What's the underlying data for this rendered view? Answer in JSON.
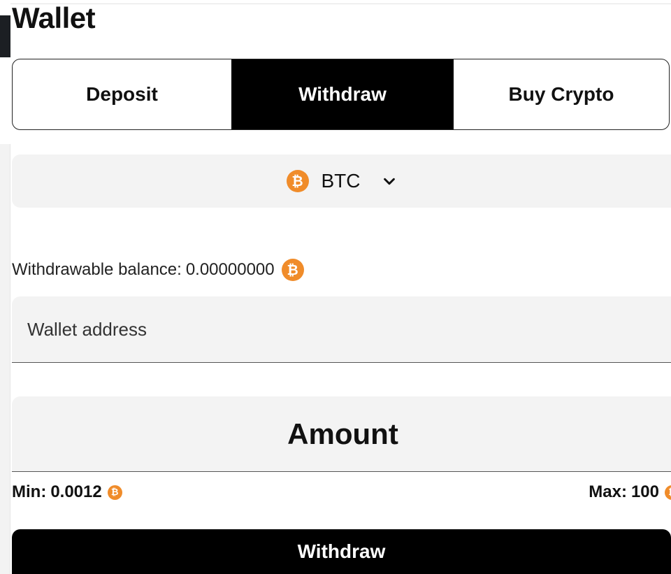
{
  "wallet": {
    "title": "Wallet",
    "tabs": [
      {
        "label": "Deposit",
        "active": false
      },
      {
        "label": "Withdraw",
        "active": true
      },
      {
        "label": "Buy Crypto",
        "active": false
      }
    ],
    "currency": {
      "code": "BTC",
      "icon": "bitcoin-icon",
      "icon_glyph": "₿",
      "dropdown_icon": "chevron-down-icon"
    },
    "balance": {
      "label": "Withdrawable balance:",
      "value": "0.00000000"
    },
    "address": {
      "placeholder": "Wallet address",
      "value": ""
    },
    "amount": {
      "placeholder": "Amount",
      "value": ""
    },
    "limits": {
      "min_label": "Min:",
      "min_value": "0.0012",
      "max_label": "Max:",
      "max_value": "100"
    },
    "submit_label": "Withdraw"
  },
  "colors": {
    "accent": "#000000",
    "coin": "#f08c2a",
    "field_bg": "#f3f3f3"
  }
}
